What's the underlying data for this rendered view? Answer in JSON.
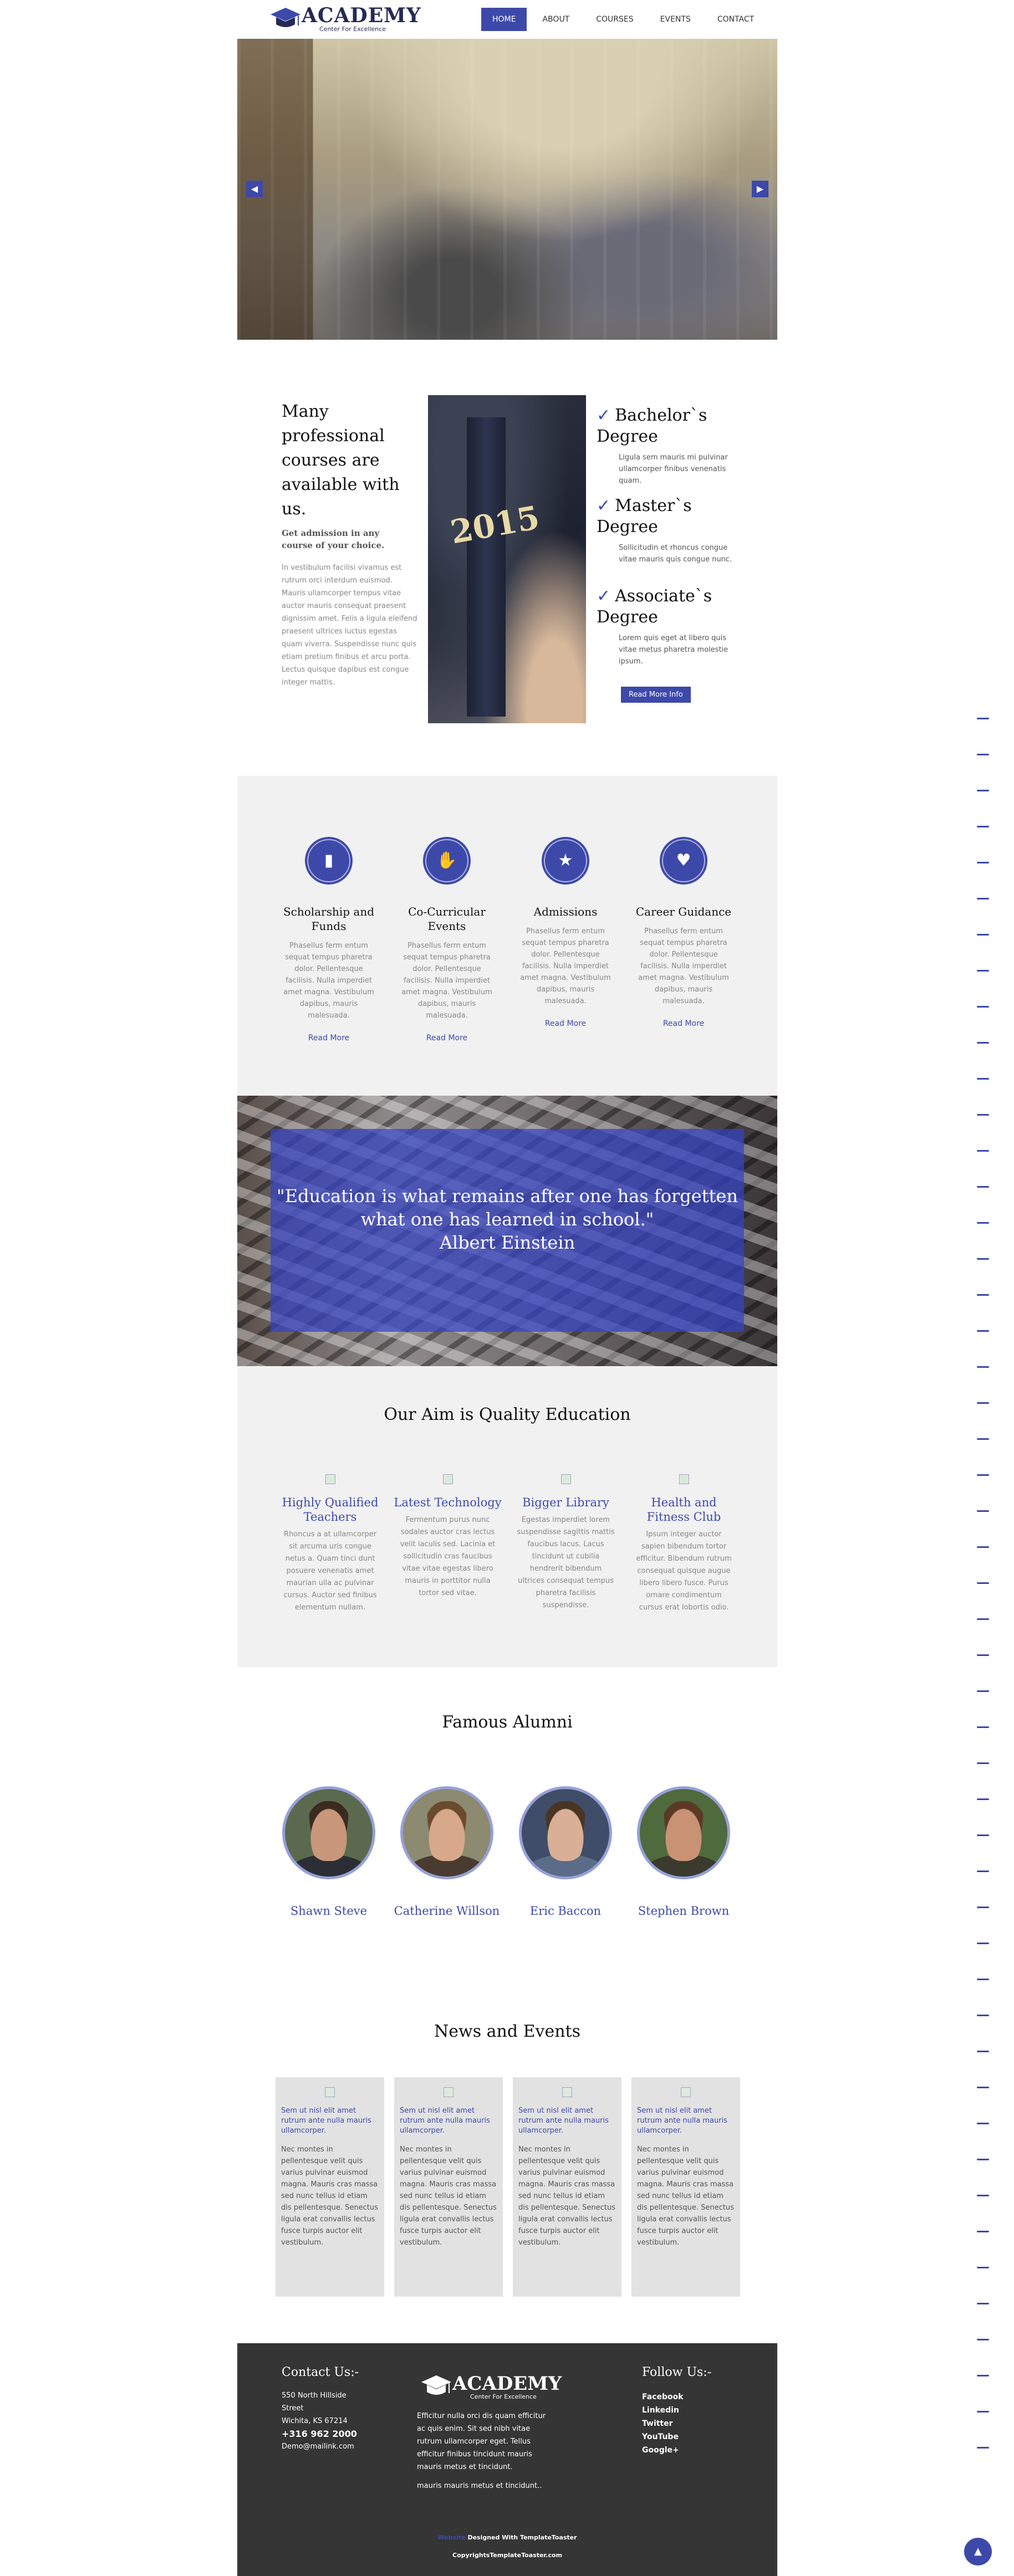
{
  "header": {
    "logo_title": "ACADEMY",
    "logo_sub": "Center For Excellence",
    "nav": [
      {
        "label": "HOME",
        "active": true
      },
      {
        "label": "ABOUT",
        "active": false
      },
      {
        "label": "COURSES",
        "active": false
      },
      {
        "label": "EVENTS",
        "active": false
      },
      {
        "label": "CONTACT",
        "active": false
      }
    ]
  },
  "slider": {
    "prev_icon": "◀",
    "next_icon": "▶"
  },
  "intro": {
    "heading": "Many professional courses are available with us.",
    "lead": "Get admission in any course of your choice.",
    "body": "In vestibulum facilisi vivamus est rutrum orci interdum euismod. Mauris ullamcorper tempus vitae auctor mauris consequat praesent dignissim amet. Felis a ligula eleifend praesent ultrices luctus egestas quam viverra. Suspendisse nunc quis etiam pretium finibus et arcu porta. Lectus quisque dapibus est congue integer mattis.",
    "image_year": "2015",
    "degrees": [
      {
        "title": "Bachelor`s Degree",
        "text": "Ligula sem mauris mi pulvinar ullamcorper finibus venenatis quam."
      },
      {
        "title": "Master`s Degree",
        "text": "Sollicitudin et rhoncus congue vitae mauris quis congue nunc."
      },
      {
        "title": "Associate`s Degree",
        "text": "Lorem quis eget at libero quis vitae metus pharetra molestie ipsum."
      }
    ],
    "button": "Read More Info"
  },
  "features": [
    {
      "icon": "book-icon",
      "glyph": "▮",
      "title": "Scholarship and Funds",
      "text": "Phasellus ferm entum sequat tempus pharetra dolor. Pellentesque facilisis. Nulla imperdiet amet magna. Vestibulum dapibus, mauris malesuada.",
      "more": "Read More"
    },
    {
      "icon": "hand-icon",
      "glyph": "✋",
      "title": "Co-Curricular Events",
      "text": "Phasellus ferm entum sequat tempus pharetra dolor. Pellentesque facilisis. Nulla imperdiet amet magna. Vestibulum dapibus, mauris malesuada.",
      "more": "Read More"
    },
    {
      "icon": "star-icon",
      "glyph": "★",
      "title": "Admissions",
      "text": "Phasellus ferm entum sequat tempus pharetra dolor. Pellentesque facilisis. Nulla imperdiet amet magna. Vestibulum dapibus, mauris malesuada.",
      "more": "Read More"
    },
    {
      "icon": "heart-icon",
      "glyph": "♥",
      "title": "Career Guidance",
      "text": "Phasellus ferm entum sequat tempus pharetra dolor. Pellentesque facilisis. Nulla imperdiet amet magna. Vestibulum dapibus, mauris malesuada.",
      "more": "Read More"
    }
  ],
  "quote": {
    "text": "\"Education is what remains after one has forgetten what one has learned in school.\"",
    "author": "Albert Einstein"
  },
  "aim": {
    "heading": "Our Aim is Quality Education",
    "items": [
      {
        "title": "Highly Qualified Teachers",
        "text": "Rhoncus a at ullamcorper sit arcuma uris congue netus a. Quam tinci dunt posuere venenatis amet maurian ulla ac pulvinar cursus. Auctor sed finibus elementum nullam."
      },
      {
        "title": "Latest Technology",
        "text": "Fermentum purus nunc sodales auctor cras lectus velit iaculis sed. Lacinia et sollicitudin cras faucibus vitae vitae egestas libero  mauris in porttitor nulla tortor sed vitae."
      },
      {
        "title": "Bigger Library",
        "text": "Egestas imperdiet lorem suspendisse sagittis mattis faucibus lacus. Lacus tincidunt ut cubilia hendrerit bibendum ultrices consequat tempus pharetra facilisis suspendisse."
      },
      {
        "title": "Health and Fitness Club",
        "text": "Ipsum integer auctor sapien bibendum tortor efficitur. Bibendum rutrum consequat quisque augue libero libero fusce. Purus ornare condimentum cursus erat lobortis odio."
      }
    ]
  },
  "alumni": {
    "heading": "Famous Alumni",
    "people": [
      {
        "name": "Shawn Steve",
        "skin": "#c9977a",
        "hair": "#3b2a1f",
        "shirt": "#2b2f35",
        "bg": "#5b6a4f"
      },
      {
        "name": "Catherine Willson",
        "skin": "#d7a98a",
        "hair": "#6b4a2e",
        "shirt": "#4a3b30",
        "bg": "#8c8a70"
      },
      {
        "name": "Eric Baccon",
        "skin": "#d9b096",
        "hair": "#4a3524",
        "shirt": "#5b6c88",
        "bg": "#3f4d68"
      },
      {
        "name": "Stephen Brown",
        "skin": "#c99275",
        "hair": "#5a3a25",
        "shirt": "#3a3a2e",
        "bg": "#4f6a3c"
      }
    ]
  },
  "news": {
    "heading": "News and Events",
    "cards": [
      {
        "title": "Sem ut nisl elit amet rutrum ante nulla mauris ullamcorper.",
        "text": "Nec montes in pellentesque velit quis varius pulvinar euismod magna. Mauris cras massa sed nunc tellus id etiam dis pellentesque. Senectus ligula erat convallis lectus fusce turpis auctor elit vestibulum."
      },
      {
        "title": "Sem ut nisl elit amet rutrum ante nulla mauris ullamcorper.",
        "text": "Nec montes in pellentesque velit quis varius pulvinar euismod magna. Mauris cras massa sed nunc tellus id etiam dis pellentesque. Senectus ligula erat convallis lectus fusce turpis auctor elit vestibulum."
      },
      {
        "title": "Sem ut nisl elit amet rutrum ante nulla mauris ullamcorper.",
        "text": "Nec montes in pellentesque velit quis varius pulvinar euismod magna. Mauris cras massa sed nunc tellus id etiam dis pellentesque. Senectus ligula erat convallis lectus fusce turpis auctor elit vestibulum."
      },
      {
        "title": "Sem ut nisl elit amet rutrum ante nulla mauris ullamcorper.",
        "text": "Nec montes in pellentesque velit quis varius pulvinar euismod magna. Mauris cras massa sed nunc tellus id etiam dis pellentesque. Senectus ligula erat convallis lectus fusce turpis auctor elit vestibulum."
      }
    ]
  },
  "footer": {
    "contact_heading": "Contact Us:-",
    "address1": "550 North Hillside",
    "address2": "Street",
    "address3": "Wichita, KS 67214",
    "phone": "+316 962 2000",
    "email": "Demo@mailink.com",
    "logo_title": "ACADEMY",
    "logo_sub": "Center For Excellence",
    "about": "Efficitur nulla orci dis quam efficitur ac quis enim. Sit sed nibh vitae rutrum ullamcorper eget. Tellus efficitur  finibus tincidunt mauris mauris metus et tincidunt.",
    "about2": "mauris mauris metus et tincidunt..",
    "follow_heading": "Follow Us:-",
    "social": [
      "Facebook",
      "Linkedin",
      "Twitter",
      "YouTube",
      "Google+"
    ],
    "credit_link": "Website",
    "credit_text": " Designed With TemplateToaster",
    "copyright": "CopyrightsTemplateToaster.com"
  },
  "to_top_icon": "▲",
  "colors": {
    "accent": "#3d49a9",
    "footer_bg": "#353535",
    "section_bg": "#f1f1f1"
  }
}
